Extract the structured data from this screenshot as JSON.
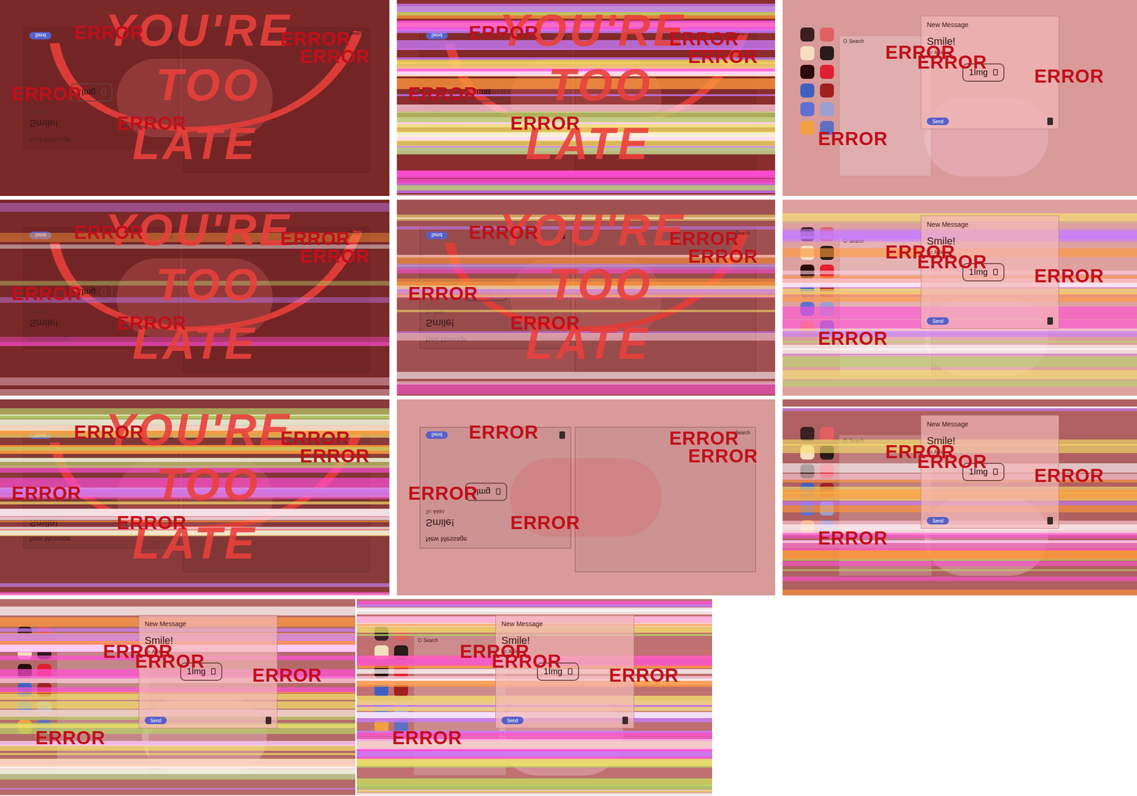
{
  "frames": [
    {
      "kind": "too-late",
      "color": "#7a2828",
      "glitch": 0,
      "graffiti": [
        "YOU'RE",
        "TOO",
        "LATE"
      ],
      "window": {
        "title": "New Message",
        "subject": "Smile!",
        "to": "To: Aikko",
        "attachment": "1Img",
        "send": "Send",
        "search": "Search"
      },
      "errors": [
        "ERROR",
        "ERROR",
        "ERROR",
        "ERROR",
        "ERROR"
      ]
    },
    {
      "kind": "too-late",
      "color": "#8a2d2d",
      "glitch": 0.9,
      "graffiti": [
        "YOU'RE",
        "TOO",
        "LATE"
      ],
      "window": {
        "title": "New Message",
        "subject": "Smile!",
        "to": "To: Aikko",
        "attachment": "1Img",
        "send": "Send",
        "search": "Search"
      },
      "errors": [
        "ERROR",
        "ERROR",
        "ERROR",
        "ERROR",
        "ERROR"
      ]
    },
    {
      "kind": "desktop",
      "color": "#d99a9a",
      "glitch": 0,
      "graffiti": [],
      "window": {
        "title": "New Message",
        "subject": "Smile!",
        "to": "To: Aikko",
        "attachment": "1Img",
        "send": "Send",
        "search": "Search"
      },
      "errors": [
        "ERROR",
        "ERROR",
        "ERROR",
        "ERROR"
      ]
    },
    {
      "kind": "too-late",
      "color": "#7a2828",
      "glitch": 0.2,
      "graffiti": [
        "YOU'RE",
        "TOO",
        "LATE"
      ],
      "window": {
        "title": "New Message",
        "subject": "Smile!",
        "to": "To: Aikko",
        "attachment": "1Img",
        "send": "Send",
        "search": "Search"
      },
      "errors": [
        "ERROR",
        "ERROR",
        "ERROR",
        "ERROR",
        "ERROR"
      ]
    },
    {
      "kind": "too-late",
      "color": "#a05050",
      "glitch": 0.5,
      "graffiti": [
        "YOU'RE",
        "TOO",
        "LATE"
      ],
      "window": {
        "title": "New Message",
        "subject": "Smile!",
        "to": "To: Aikko",
        "attachment": "1Img",
        "send": "Send",
        "search": "Search"
      },
      "errors": [
        "ERROR",
        "ERROR",
        "ERROR",
        "ERROR",
        "ERROR"
      ]
    },
    {
      "kind": "desktop",
      "color": "#dfa0a0",
      "glitch": 0.6,
      "graffiti": [],
      "window": {
        "title": "New Message",
        "subject": "Smile!",
        "to": "To: Aikko",
        "attachment": "1Img",
        "send": "Send",
        "search": "Search"
      },
      "errors": [
        "ERROR",
        "ERROR",
        "ERROR",
        "ERROR"
      ]
    },
    {
      "kind": "too-late",
      "color": "#8a3a3a",
      "glitch": 0.7,
      "graffiti": [
        "YOU'RE",
        "TOO",
        "LATE"
      ],
      "window": {
        "title": "New Message",
        "subject": "Smile!",
        "to": "To: Aikko",
        "attachment": "1Img",
        "send": "Send",
        "search": "Search"
      },
      "errors": [
        "ERROR",
        "ERROR",
        "ERROR",
        "ERROR",
        "ERROR"
      ]
    },
    {
      "kind": "mail",
      "color": "#d99a9a",
      "glitch": 0,
      "graffiti": [],
      "window": {
        "title": "New Message",
        "subject": "Smile!",
        "to": "To: Aikko",
        "attachment": "1Img",
        "send": "Send",
        "search": "Search"
      },
      "errors": [
        "ERROR",
        "ERROR",
        "ERROR",
        "ERROR",
        "ERROR"
      ]
    },
    {
      "kind": "desktop",
      "color": "#b06060",
      "glitch": 0.6,
      "graffiti": [],
      "window": {
        "title": "New Message",
        "subject": "Smile!",
        "to": "To: Aikko",
        "attachment": "1Img",
        "send": "Send",
        "search": "Search"
      },
      "errors": [
        "ERROR",
        "ERROR",
        "ERROR",
        "ERROR"
      ]
    },
    {
      "kind": "desktop",
      "color": "#b56a6a",
      "glitch": 0.8,
      "graffiti": [],
      "window": {
        "title": "New Message",
        "subject": "Smile!",
        "to": "To: Aikko",
        "attachment": "1Img",
        "send": "Send",
        "search": "Search"
      },
      "errors": [
        "ERROR",
        "ERROR",
        "ERROR",
        "ERROR"
      ]
    },
    {
      "kind": "desktop",
      "color": "#c07070",
      "glitch": 0.9,
      "graffiti": [],
      "window": {
        "title": "New Message",
        "subject": "Smile!",
        "to": "To: Aikko",
        "attachment": "1Img",
        "send": "Send",
        "search": "Search"
      },
      "errors": [
        "ERROR",
        "ERROR",
        "ERROR",
        "ERROR"
      ]
    }
  ]
}
